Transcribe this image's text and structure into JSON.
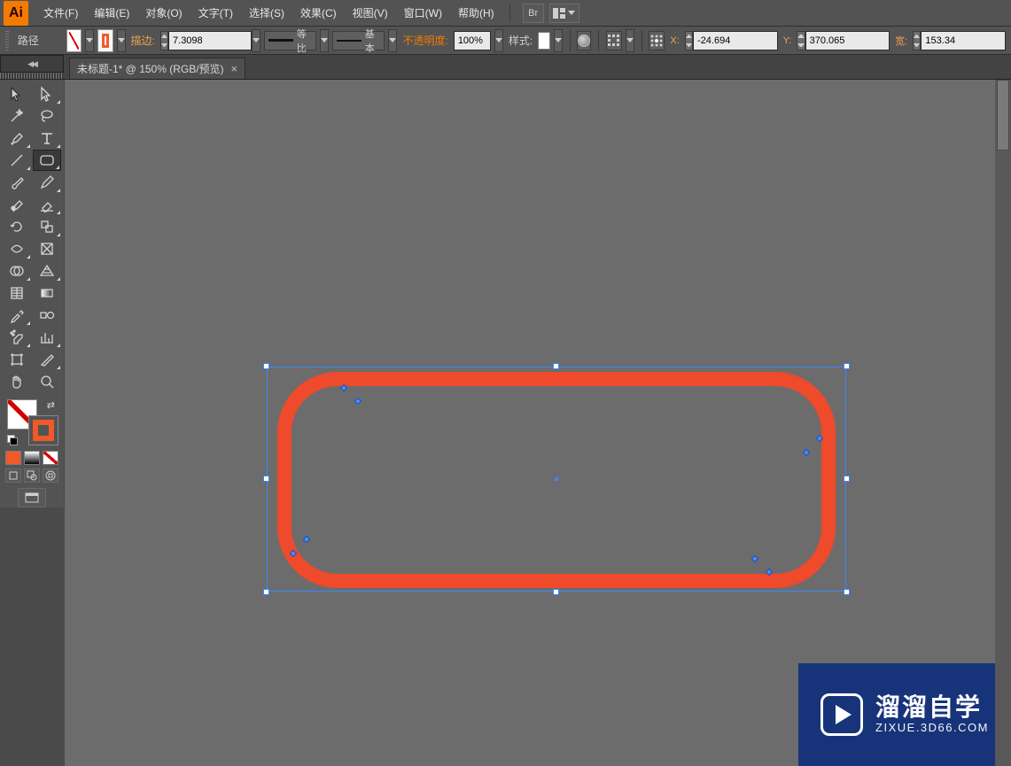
{
  "app_logo": "Ai",
  "menu": {
    "file": "文件(F)",
    "edit": "编辑(E)",
    "object": "对象(O)",
    "type": "文字(T)",
    "select": "选择(S)",
    "effect": "效果(C)",
    "view": "视图(V)",
    "window": "窗口(W)",
    "help": "帮助(H)",
    "bridge": "Br"
  },
  "ctrl": {
    "selection_label": "路径",
    "stroke_label": "描边:",
    "stroke_weight": "7.3098",
    "profile_uniform": "等比",
    "brush_basic": "基本",
    "opacity_label": "不透明度:",
    "opacity_value": "100%",
    "style_label": "样式:",
    "x_label": "X:",
    "x_value": "-24.694",
    "y_label": "Y:",
    "y_value": "370.065",
    "w_label": "宽:",
    "w_value": "153.34"
  },
  "tab": {
    "title": "未标题-1* @ 150% (RGB/预览)",
    "close": "×"
  },
  "watermark": {
    "cn": "溜溜自学",
    "en": "ZIXUE.3D66.COM"
  },
  "tools": {
    "selection": "selection",
    "direct": "direct-selection",
    "wand": "magic-wand",
    "lasso": "lasso",
    "pen": "pen",
    "type": "type",
    "line": "line",
    "rect": "rounded-rectangle",
    "brush": "paintbrush",
    "pencil": "pencil",
    "blob": "blob-brush",
    "eraser": "eraser",
    "rotate": "rotate",
    "reflect": "width",
    "warp": "scale",
    "free": "free-transform",
    "shapeb": "shape-builder",
    "persp": "perspective-grid",
    "mesh": "mesh",
    "gradient": "gradient",
    "eyedrop": "eyedropper",
    "blend": "blend",
    "symbol": "symbol-sprayer",
    "graph": "column-graph",
    "artboard": "artboard",
    "slice": "slice",
    "hand": "hand",
    "zoom": "zoom"
  }
}
